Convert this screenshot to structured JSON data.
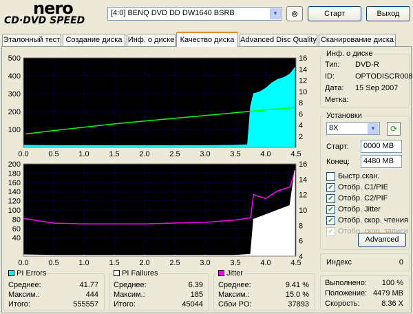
{
  "header": {
    "logo_line1": "nero",
    "logo_line2": "CD·DVD SPEED",
    "drive": "[4:0]  BENQ DVD DD DW1640 BSRB",
    "start_label": "Старт",
    "exit_label": "Выход"
  },
  "tabs": [
    {
      "label": "Эталонный тест"
    },
    {
      "label": "Создание диска"
    },
    {
      "label": "Инф. о диске"
    },
    {
      "label": "Качество диска",
      "active": true
    },
    {
      "label": "Advanced Disc Quality"
    },
    {
      "label": "Сканирование диска"
    }
  ],
  "disc_info": {
    "title": "Инф. о диске",
    "type_label": "Тип:",
    "type_value": "DVD-R",
    "id_label": "ID:",
    "id_value": "OPTODISCR008",
    "date_label": "Дата:",
    "date_value": "15 Sep 2007",
    "mark_label": "Метка:",
    "mark_value": ""
  },
  "settings": {
    "title": "Установки",
    "speed": "8X",
    "start_label": "Старт:",
    "start_value": "0000 MB",
    "end_label": "Конец:",
    "end_value": "4480 MB",
    "checkboxes": [
      {
        "label": "Быстр.скан.",
        "checked": false,
        "disabled": false
      },
      {
        "label": "Отобр. C1/PIE",
        "checked": true,
        "disabled": false
      },
      {
        "label": "Отобр. C2/PIF",
        "checked": true,
        "disabled": false
      },
      {
        "label": "Отобр. Jitter",
        "checked": true,
        "disabled": false
      },
      {
        "label": "Отобр. скор. чтения",
        "checked": true,
        "disabled": false
      },
      {
        "label": "Отобр. скор. записи",
        "checked": true,
        "disabled": true
      }
    ],
    "advanced_label": "Advanced"
  },
  "index": {
    "label": "Индекс",
    "value": "0"
  },
  "progress": {
    "done_label": "Выполнено:",
    "done_value": "100 %",
    "position_label": "Положение:",
    "position_value": "4479 MB",
    "speed_label": "Скорость:",
    "speed_value": "8.36 X"
  },
  "stats": {
    "pi_errors": {
      "title": "PI Errors",
      "color": "#00ffff",
      "avg_label": "Среднее:",
      "avg": "41.77",
      "max_label": "Максим.:",
      "max": "444",
      "total_label": "Итого:",
      "total": "555557"
    },
    "pi_failures": {
      "title": "PI Failures",
      "color": "#ffffff",
      "avg_label": "Среднее:",
      "avg": "6.39",
      "max_label": "Максим.:",
      "max": "185",
      "total_label": "Итого:",
      "total": "45044"
    },
    "jitter": {
      "title": "Jitter",
      "color": "#ff00ff",
      "avg_label": "Среднее:",
      "avg": "9.41 %",
      "max_label": "Максим.:",
      "max": "15.0 %",
      "po_label": "Сбои PO:",
      "po": "37893"
    }
  },
  "chart_data": [
    {
      "type": "area",
      "xlim": [
        0,
        4.5
      ],
      "x_ticks": [
        "0.0",
        "0.5",
        "1.0",
        "1.5",
        "2.0",
        "2.5",
        "3.0",
        "3.5",
        "4.0",
        "4.5"
      ],
      "ylim_left": [
        0,
        500
      ],
      "y_ticks_left": [
        "100",
        "200",
        "300",
        "400",
        "500"
      ],
      "ylim_right": [
        0,
        16
      ],
      "y_ticks_right": [
        "2",
        "4",
        "6",
        "8",
        "10",
        "12",
        "14",
        "16"
      ],
      "grid": true,
      "series": [
        {
          "color": "#00ffff",
          "x": [
            0.0,
            0.5,
            1.0,
            1.5,
            2.0,
            2.5,
            3.0,
            3.5,
            3.7,
            3.75,
            3.8,
            3.9,
            4.0,
            4.1,
            4.2,
            4.3,
            4.4,
            4.48
          ],
          "values": [
            12,
            10,
            10,
            10,
            10,
            10,
            10,
            12,
            15,
            230,
            300,
            310,
            330,
            360,
            380,
            390,
            410,
            444
          ]
        },
        {
          "color": "#00ff00",
          "axis": "right",
          "x": [
            0.05,
            0.5,
            1.0,
            1.5,
            2.0,
            2.5,
            3.0,
            3.5,
            4.0,
            4.48
          ],
          "values": [
            2.4,
            3.0,
            3.6,
            4.2,
            4.7,
            5.2,
            5.7,
            6.2,
            6.7,
            7.1
          ]
        }
      ]
    },
    {
      "type": "area",
      "xlim": [
        0,
        4.5
      ],
      "x_ticks": [
        "0.0",
        "0.5",
        "1.0",
        "1.5",
        "2.0",
        "2.5",
        "3.0",
        "3.5",
        "4.0",
        "4.5"
      ],
      "ylim_left": [
        0,
        200
      ],
      "y_ticks_left": [
        "40",
        "60",
        "80",
        "100",
        "120",
        "140",
        "160",
        "180",
        "200"
      ],
      "ylim_right": [
        4,
        16
      ],
      "y_ticks_right": [
        "4",
        "6",
        "8",
        "10",
        "12",
        "14",
        "16"
      ],
      "grid": true,
      "series": [
        {
          "color": "#ff00ff",
          "axis": "right",
          "x": [
            0.0,
            0.5,
            1.0,
            1.5,
            2.0,
            2.5,
            3.0,
            3.5,
            3.75,
            3.8,
            4.0,
            4.2,
            4.4,
            4.48
          ],
          "values": [
            8.9,
            8.3,
            8.2,
            8.2,
            8.2,
            8.3,
            8.4,
            8.7,
            9.0,
            12.0,
            11.5,
            12.5,
            13.0,
            15.0
          ]
        },
        {
          "color": "#ffffff",
          "x": [
            0.0,
            0.5,
            1.0,
            1.5,
            2.0,
            2.5,
            3.0,
            3.5,
            3.75,
            3.8,
            4.0,
            4.2,
            4.4,
            4.48
          ],
          "values": [
            3,
            2,
            2,
            2,
            2,
            2,
            2,
            2,
            4,
            80,
            90,
            100,
            110,
            185
          ]
        }
      ]
    }
  ]
}
